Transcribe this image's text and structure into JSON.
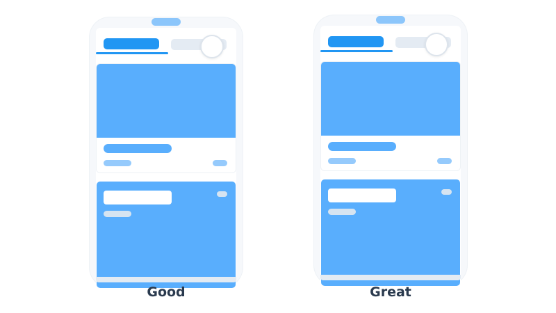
{
  "mockups": [
    {
      "caption": "Good"
    },
    {
      "caption": "Great"
    }
  ],
  "colors": {
    "accent": "#2196f3",
    "card_blue": "#59aefd",
    "placeholder_light": "#95cafc",
    "inactive_tab": "#e4ebf3",
    "caption_text": "#2a3a4e"
  }
}
